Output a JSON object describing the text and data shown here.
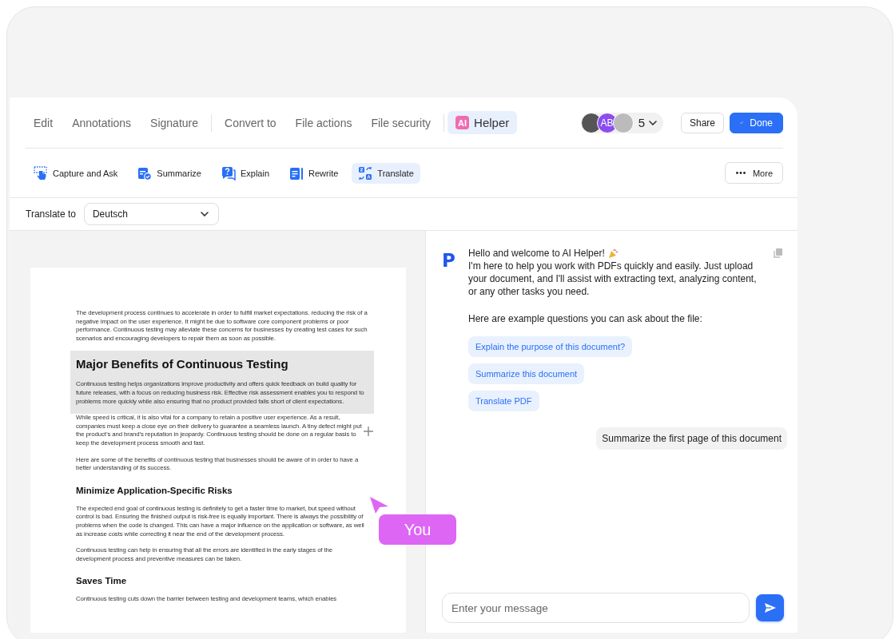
{
  "menu_groups": [
    [
      {
        "label": "Edit",
        "selected": false
      },
      {
        "label": "Annotations",
        "selected": false
      },
      {
        "label": "Signature",
        "selected": false
      }
    ],
    [
      {
        "label": "Convert to",
        "selected": false
      },
      {
        "label": "File actions",
        "selected": false
      },
      {
        "label": "File security",
        "selected": false
      }
    ],
    [
      {
        "label": "Helper",
        "badge": "AI",
        "selected": true
      }
    ]
  ],
  "collaborators": {
    "avatars": [
      {
        "kind": "photo"
      },
      {
        "kind": "initials",
        "initials": "AB"
      },
      {
        "kind": "photo"
      }
    ],
    "count": "5"
  },
  "actions": [
    {
      "label": "Share",
      "kind": "secondary"
    },
    {
      "label": "Done",
      "kind": "primary"
    }
  ],
  "ai_tools": [
    {
      "label": "Capture and Ask",
      "kind": "capture",
      "selected": false
    },
    {
      "label": "Summarize",
      "kind": "summarize",
      "selected": false
    },
    {
      "label": "Explain",
      "kind": "explain",
      "selected": false
    },
    {
      "label": "Rewrite",
      "kind": "rewrite",
      "selected": false
    },
    {
      "label": "Translate",
      "kind": "translate",
      "selected": true
    }
  ],
  "more_button": {
    "label": "More"
  },
  "translate_bar": {
    "label": "Translate to",
    "value": "Deutsch"
  },
  "document": {
    "blocks": [
      {
        "kind": "paragraph",
        "selected": false,
        "text": "The development process continues to accelerate in order to fulfill market expectations. reducing the risk of a negative impact on the user experience. It might be due to software core component problems or poor performance. Continuous testing may alleviate these concerns for businesses by creating test cases for such scenarios and encouraging developers to repair them as soon as possible."
      },
      {
        "kind": "title",
        "selected": true,
        "text": "Major Benefits of Continuous Testing"
      },
      {
        "kind": "paragraph",
        "selected": true,
        "text": "Continuous testing helps organizations improve productivity and offers quick feedback on build quality for future releases, with a focus on reducing business risk. Effective risk assessment enables you to respond to problems more quickly while also ensuring that no product provided falls short of client expectations."
      },
      {
        "kind": "paragraph",
        "selected": false,
        "text": "While speed is critical, it is also vital for a company to retain a positive user experience. As a result, companies must keep a close eye on their delivery to guarantee a seamless launch. A tiny defect might put the product’s and brand’s reputation in jeopardy. Continuous testing should be done on a regular basis to keep the development process smooth and fast."
      },
      {
        "kind": "paragraph",
        "selected": false,
        "text": "Here are some of the benefits of continuous testing that businesses should be aware of in order to have a better understanding of its success."
      },
      {
        "kind": "heading",
        "selected": false,
        "text": "Minimize Application-Specific Risks"
      },
      {
        "kind": "paragraph",
        "selected": false,
        "text": "The expected end goal of continuous testing is definitely to get a faster time to market, but speed without control is bad. Ensuring the finished output is risk-free is equally important. There is always the possibility of problems when the code is changed. This can have a major influence on the application or software, as well as increase costs while correcting it near the end of the development process."
      },
      {
        "kind": "paragraph",
        "selected": false,
        "text": "Continuous testing can help in ensuring that all the errors are identified in the early stages of the development process and preventive measures can be taken."
      },
      {
        "kind": "heading",
        "selected": false,
        "text": "Saves Time"
      },
      {
        "kind": "paragraph",
        "selected": false,
        "text": "Continuous testing cuts down the barrier between testing and development teams, which enables"
      }
    ]
  },
  "cursor": {
    "label": "You"
  },
  "chat": {
    "logo": "P",
    "messages": [
      {
        "kind": "assistant",
        "greeting": "Hello and welcome to AI Helper!",
        "text": "I'm here to help you work with PDFs quickly and easily. Just upload your document, and I'll assist with extracting text, analyzing content, or any other tasks you need.",
        "prompt": "Here are example questions you can ask about the file:",
        "suggestions": [
          "Explain the purpose of this document?",
          "Summarize this document",
          "Translate PDF"
        ]
      },
      {
        "kind": "user",
        "text": "Summarize the first page of this document"
      }
    ],
    "input": {
      "placeholder": "Enter your message"
    }
  }
}
